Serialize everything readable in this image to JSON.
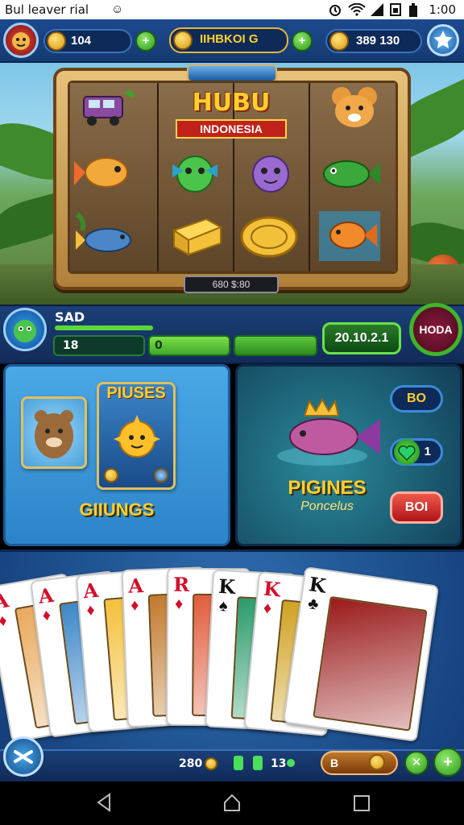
{
  "status_bar": {
    "left_text": "Bul leaver rial",
    "right_text": "1:00"
  },
  "hud": {
    "coins_value": "104",
    "title": "IIHBKOI G",
    "gems_value": "389 130"
  },
  "slot": {
    "logo_title": "HUBU",
    "logo_subtitle": "INDONESIA",
    "reel_info": "680   $:80"
  },
  "player": {
    "name": "SAD",
    "stat1": "18",
    "stat2": "0",
    "balance": "20.10.2.1",
    "mode_button": "HODA"
  },
  "promo_left": {
    "heading": "PIUSES",
    "caption": "GIIUNGS"
  },
  "promo_right": {
    "heading": "PIGINES",
    "subheading": "Poncelus",
    "btn1": "BO",
    "btn2": "1",
    "btn3": "BOI"
  },
  "cards": [
    {
      "rank": "A",
      "suit": "♦",
      "color": "#d0102a"
    },
    {
      "rank": "A",
      "suit": "♦",
      "color": "#d0102a"
    },
    {
      "rank": "A",
      "suit": "♦",
      "color": "#d0102a"
    },
    {
      "rank": "A",
      "suit": "♦",
      "color": "#d0102a"
    },
    {
      "rank": "R",
      "suit": "♦",
      "color": "#d0102a"
    },
    {
      "rank": "K",
      "suit": "♠",
      "color": "#111"
    },
    {
      "rank": "K",
      "suit": "♦",
      "color": "#d0102a"
    },
    {
      "rank": "K",
      "suit": "♣",
      "color": "#111"
    }
  ],
  "bottom_bar": {
    "value1": "280",
    "value2": "13",
    "field": "B"
  },
  "icons": {
    "wifi": "wifi-icon",
    "battery": "battery-icon",
    "star": "star-icon"
  },
  "colors": {
    "accent_green": "#3fb52a",
    "hud_blue": "#153a72",
    "gold": "#ffcf2e"
  }
}
